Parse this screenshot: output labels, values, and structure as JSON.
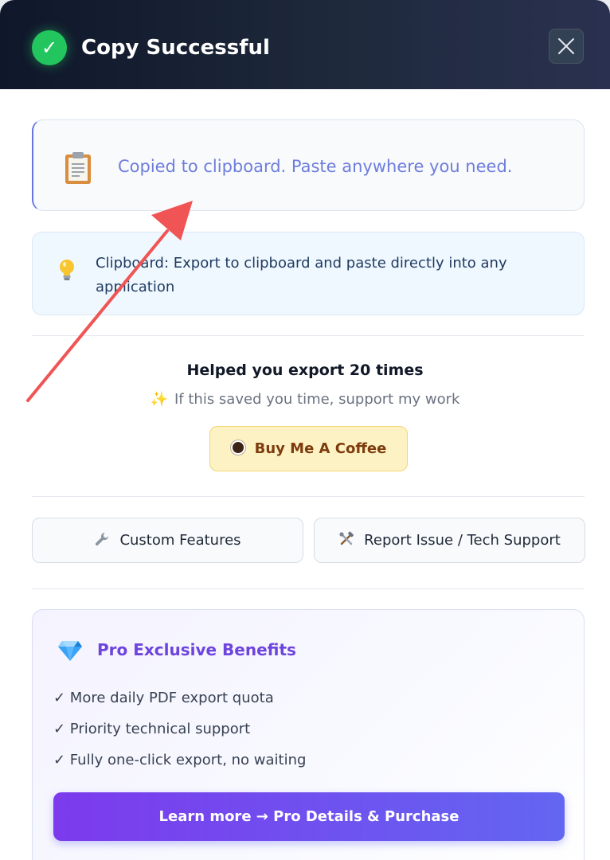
{
  "header": {
    "title": "Copy Successful",
    "check_glyph": "✓",
    "close_icon": "close-icon"
  },
  "status": {
    "message": "Copied to clipboard. Paste anywhere you need.",
    "icon": "clipboard-icon"
  },
  "tip": {
    "text": "Clipboard: Export to clipboard and paste directly into any application",
    "icon": "lightbulb-icon"
  },
  "support": {
    "helped": "Helped you export 20 times",
    "sparkle": "✨",
    "line": "If this saved you time, support my work",
    "coffee_label": "Buy Me A Coffee"
  },
  "actions": {
    "custom_features": "Custom Features",
    "report_issue": "Report Issue / Tech Support"
  },
  "pro": {
    "title": "Pro Exclusive Benefits",
    "benefits": [
      "✓ More daily PDF export quota",
      "✓ Priority technical support",
      "✓ Fully one-click export, no waiting"
    ],
    "cta": "Learn more → Pro Details & Purchase"
  },
  "colors": {
    "success": "#22c55e",
    "accent": "#6d44dd",
    "annotation_arrow": "#f05454"
  }
}
